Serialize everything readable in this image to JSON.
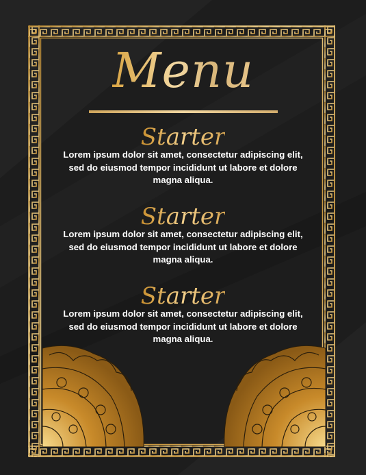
{
  "menu": {
    "title": "Menu",
    "sections": [
      {
        "heading": "Starter",
        "description": "Lorem ipsum dolor sit amet, consectetur adipiscing elit, sed do eiusmod tempor incididunt ut labore et dolore magna aliqua."
      },
      {
        "heading": "Starter",
        "description": "Lorem ipsum dolor sit amet, consectetur adipiscing elit, sed do eiusmod tempor incididunt ut labore et dolore magna aliqua."
      },
      {
        "heading": "Starter",
        "description": "Lorem ipsum dolor sit amet, consectetur adipiscing elit, sed do eiusmod tempor incididunt ut labore et dolore magna aliqua."
      }
    ]
  },
  "colors": {
    "background": "#1d1d1d",
    "gold": "#d9a544",
    "gold_light": "#f3d9a3",
    "text": "#ffffff"
  },
  "decorations": [
    "greek-key-border",
    "mandala-corner-left",
    "mandala-corner-right",
    "gold-divider"
  ]
}
